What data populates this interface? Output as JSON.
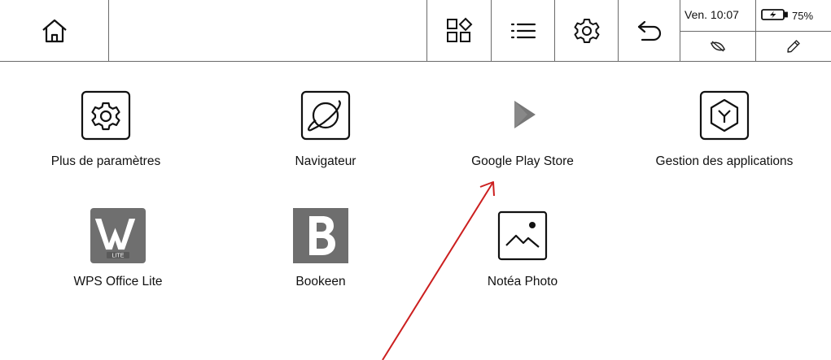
{
  "status": {
    "time": "Ven. 10:07",
    "battery": "75%"
  },
  "topbar_icons": [
    "home-icon",
    "apps-grid-icon",
    "list-icon",
    "gear-icon",
    "back-arrow-icon",
    "eye-off-icon",
    "pencil-icon",
    "battery-charging-icon"
  ],
  "apps": [
    {
      "label": "Plus de paramètres",
      "icon": "gear-icon"
    },
    {
      "label": "Navigateur",
      "icon": "browser-globe-icon"
    },
    {
      "label": "Google Play Store",
      "icon": "play-store-icon"
    },
    {
      "label": "Gestion des applications",
      "icon": "app-manager-hexagon-icon"
    },
    {
      "label": "WPS Office Lite",
      "icon": "wps-office-icon"
    },
    {
      "label": "Bookeen",
      "icon": "bookeen-b-icon"
    },
    {
      "label": "Notéa Photo",
      "icon": "photo-icon"
    }
  ],
  "colors": {
    "annotation_arrow": "#cc1f1f",
    "separator": "#6a6a6a"
  }
}
